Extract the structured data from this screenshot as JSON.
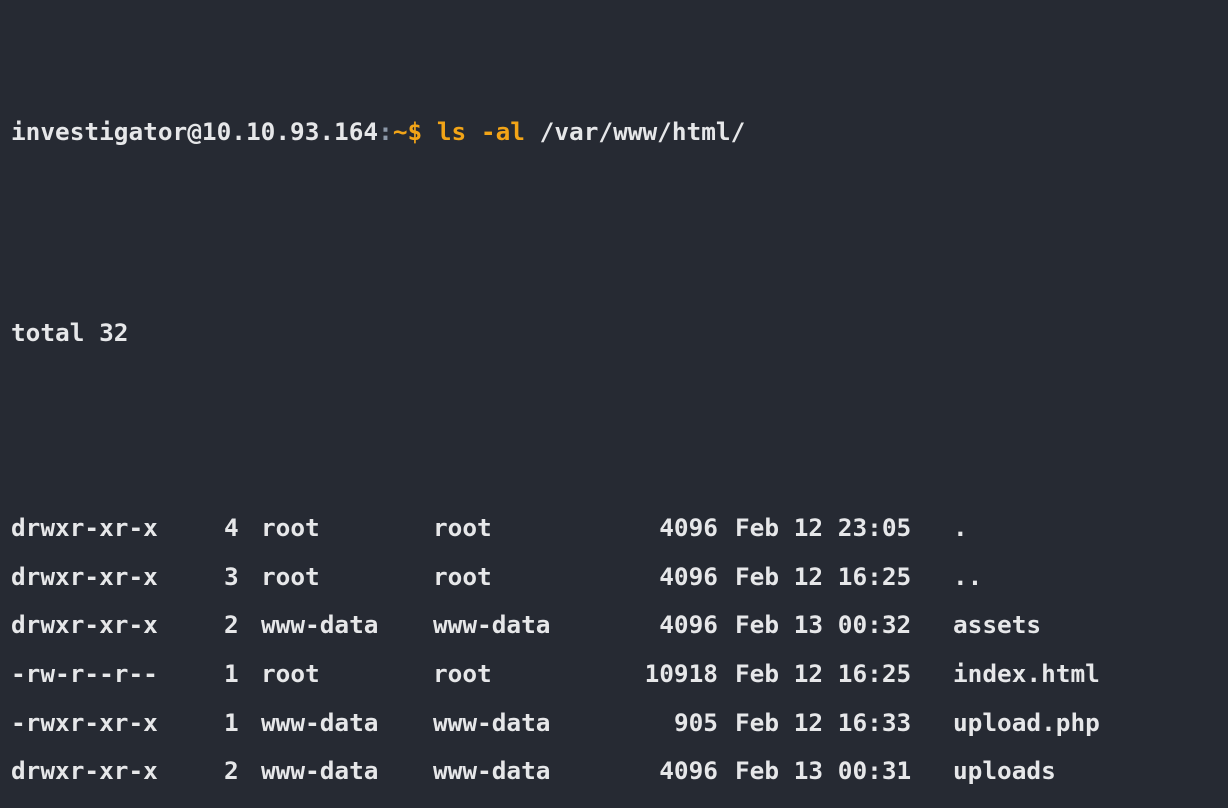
{
  "prompt": {
    "user_host": "investigator@10.10.93.164",
    "separator": ":",
    "path": "~",
    "symbol": "$",
    "command": "ls -al",
    "argument": "/var/www/html/"
  },
  "output": {
    "total": "total 32",
    "entries": [
      {
        "perm": "drwxr-xr-x",
        "links": "4",
        "owner": "root",
        "group": "root",
        "size": "4096",
        "date": "Feb 12 23:05",
        "name": "."
      },
      {
        "perm": "drwxr-xr-x",
        "links": "3",
        "owner": "root",
        "group": "root",
        "size": "4096",
        "date": "Feb 12 16:25",
        "name": ".."
      },
      {
        "perm": "drwxr-xr-x",
        "links": "2",
        "owner": "www-data",
        "group": "www-data",
        "size": "4096",
        "date": "Feb 13 00:32",
        "name": "assets"
      },
      {
        "perm": "-rw-r--r--",
        "links": "1",
        "owner": "root",
        "group": "root",
        "size": "10918",
        "date": "Feb 12 16:25",
        "name": "index.html"
      },
      {
        "perm": "-rwxr-xr-x",
        "links": "1",
        "owner": "www-data",
        "group": "www-data",
        "size": "905",
        "date": "Feb 12 16:33",
        "name": "upload.php"
      },
      {
        "perm": "drwxr-xr-x",
        "links": "2",
        "owner": "www-data",
        "group": "www-data",
        "size": "4096",
        "date": "Feb 13 00:31",
        "name": "uploads"
      }
    ]
  },
  "colors": {
    "background": "#262a33",
    "text": "#e6e7e9",
    "prompt_accent": "#f2a417",
    "separator": "#8c98a8"
  }
}
